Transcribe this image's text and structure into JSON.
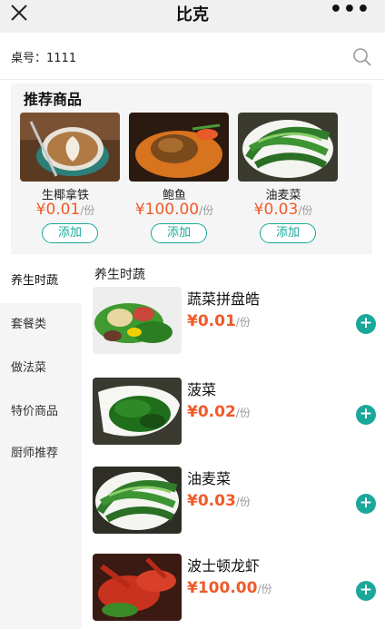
{
  "titlebar": {
    "title": "比克",
    "close_icon": "close-icon",
    "more_icon": "more-icon",
    "more_glyph": "•••"
  },
  "table": {
    "label": "桌号：1111",
    "search_icon": "search-icon"
  },
  "recommend": {
    "title": "推荐商品",
    "items": [
      {
        "name": "生椰拿铁",
        "price": "¥0.01",
        "unit": "/份",
        "button": "添加",
        "image": "latte-image"
      },
      {
        "name": "鲍鱼",
        "price": "¥100.00",
        "unit": "/份",
        "button": "添加",
        "image": "abalone-image"
      },
      {
        "name": "油麦菜",
        "price": "¥0.03",
        "unit": "/份",
        "button": "添加",
        "image": "lettuce-image"
      }
    ]
  },
  "categories": [
    {
      "label": "养生时蔬",
      "active": true
    },
    {
      "label": "套餐类",
      "active": false
    },
    {
      "label": "做法菜",
      "active": false
    },
    {
      "label": "特价商品",
      "active": false
    },
    {
      "label": "厨师推荐",
      "active": false
    }
  ],
  "menu": {
    "section_title": "养生时蔬",
    "dishes": [
      {
        "name": "蔬菜拼盘皓",
        "price": "¥0.01",
        "unit": "/份",
        "image": "veggie-platter-image"
      },
      {
        "name": "菠菜",
        "price": "¥0.02",
        "unit": "/份",
        "image": "spinach-image"
      },
      {
        "name": "油麦菜",
        "price": "¥0.03",
        "unit": "/份",
        "image": "lettuce-image"
      },
      {
        "name": "波士顿龙虾",
        "price": "¥100.00",
        "unit": "/份",
        "image": "lobster-image"
      }
    ],
    "add_glyph": "+"
  },
  "colors": {
    "accent": "#1aa89a",
    "price": "#f05a28",
    "panel": "#f5f5f5"
  }
}
